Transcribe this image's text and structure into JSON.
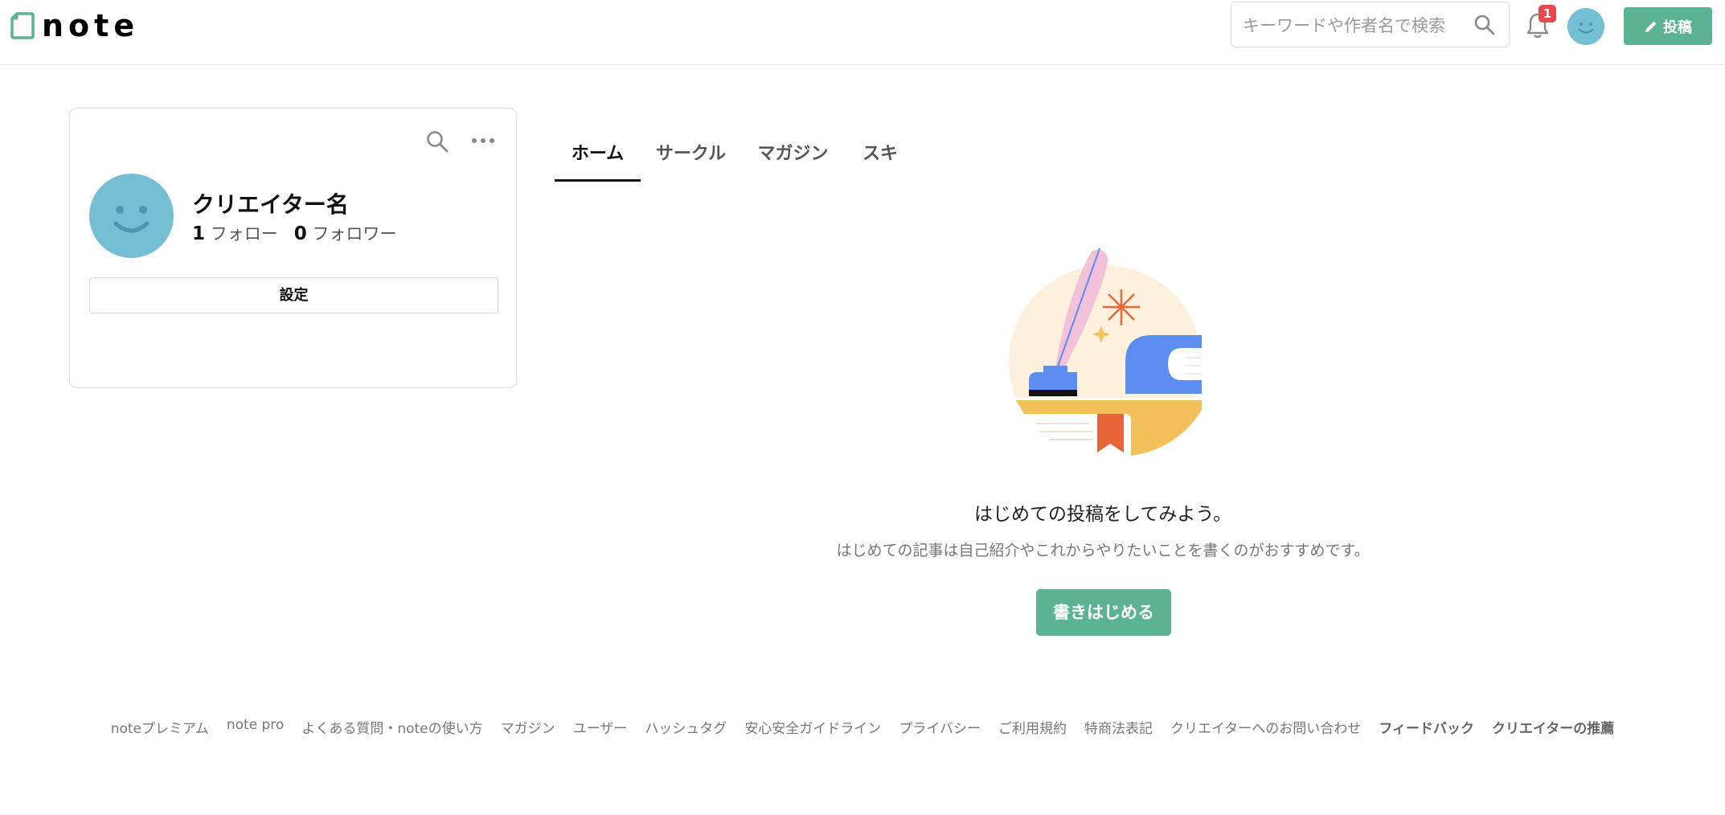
{
  "header": {
    "logo_text": "note",
    "search_placeholder": "キーワードや作者名で検索",
    "notification_count": "1",
    "post_label": "投稿"
  },
  "profile": {
    "name": "クリエイター名",
    "follow_count": "1",
    "follow_label": "フォロー",
    "follower_count": "0",
    "follower_label": "フォロワー",
    "settings_label": "設定"
  },
  "tabs": [
    {
      "label": "ホーム",
      "active": true
    },
    {
      "label": "サークル",
      "active": false
    },
    {
      "label": "マガジン",
      "active": false
    },
    {
      "label": "スキ",
      "active": false
    }
  ],
  "empty_state": {
    "title": "はじめての投稿をしてみよう。",
    "description": "はじめての記事は自己紹介やこれからやりたいことを書くのがおすすめです。",
    "button_label": "書きはじめる"
  },
  "footer": {
    "links": [
      {
        "label": "noteプレミアム",
        "bold": false
      },
      {
        "label": "note pro",
        "bold": false
      },
      {
        "label": "よくある質問・noteの使い方",
        "bold": false
      },
      {
        "label": "マガジン",
        "bold": false
      },
      {
        "label": "ユーザー",
        "bold": false
      },
      {
        "label": "ハッシュタグ",
        "bold": false
      },
      {
        "label": "安心安全ガイドライン",
        "bold": false
      },
      {
        "label": "プライバシー",
        "bold": false
      },
      {
        "label": "ご利用規約",
        "bold": false
      },
      {
        "label": "特商法表記",
        "bold": false
      },
      {
        "label": "クリエイターへのお問い合わせ",
        "bold": false
      },
      {
        "label": "フィードバック",
        "bold": true
      },
      {
        "label": "クリエイターの推薦",
        "bold": true
      }
    ]
  },
  "colors": {
    "accent": "#5bb394",
    "avatar": "#75bfd4",
    "badge": "#e5484d"
  }
}
